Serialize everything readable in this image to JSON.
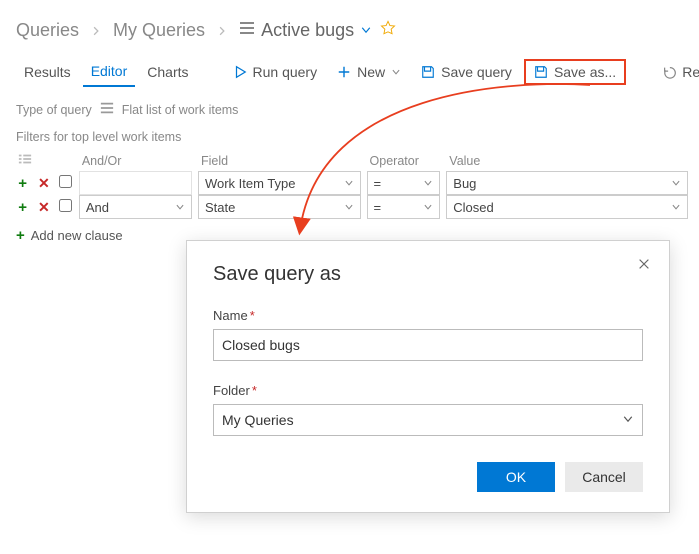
{
  "breadcrumb": {
    "root": "Queries",
    "level1": "My Queries",
    "current": "Active bugs"
  },
  "tabs": {
    "results": "Results",
    "editor": "Editor",
    "charts": "Charts"
  },
  "toolbar": {
    "run": "Run query",
    "new": "New",
    "save": "Save query",
    "saveas": "Save as...",
    "revert": "Re"
  },
  "qtype": {
    "label": "Type of query",
    "value": "Flat list of work items"
  },
  "filters": {
    "heading": "Filters for top level work items",
    "headers": {
      "andor": "And/Or",
      "field": "Field",
      "operator": "Operator",
      "value": "Value"
    },
    "rows": [
      {
        "andor": "",
        "field": "Work Item Type",
        "op": "=",
        "value": "Bug"
      },
      {
        "andor": "And",
        "field": "State",
        "op": "=",
        "value": "Closed"
      }
    ],
    "add": "Add new clause"
  },
  "dialog": {
    "title": "Save query as",
    "name_label": "Name",
    "name_value": "Closed bugs",
    "folder_label": "Folder",
    "folder_value": "My Queries",
    "ok": "OK",
    "cancel": "Cancel"
  }
}
